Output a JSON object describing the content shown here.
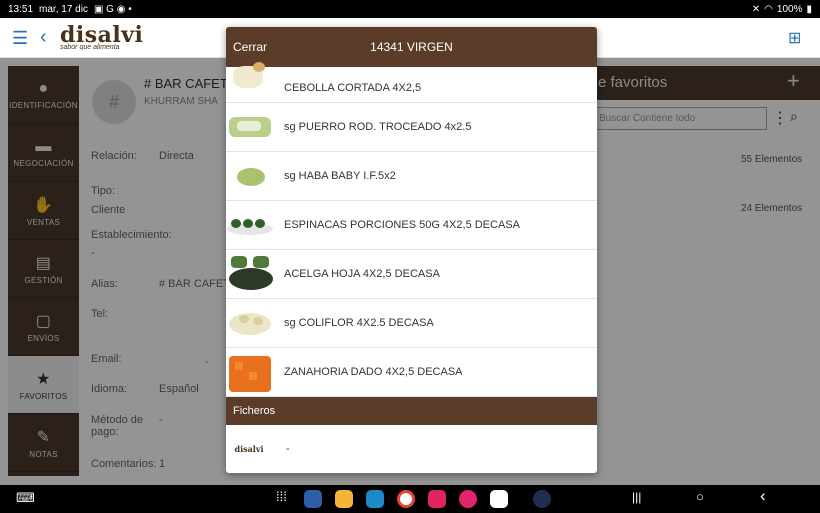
{
  "status": {
    "time": "13:51",
    "date": "mar, 17 dic",
    "battery": "100%"
  },
  "logo": {
    "brand": "disalvi",
    "tagline": "sabor que alimenta"
  },
  "sidebar": {
    "items": [
      {
        "label": "IDENTIFICACIÓN",
        "icon": "person-icon"
      },
      {
        "label": "NEGOCIACIÓN",
        "icon": "briefcase-icon"
      },
      {
        "label": "VENTAS",
        "icon": "handshake-icon"
      },
      {
        "label": "GESTIÓN",
        "icon": "clipboard-icon"
      },
      {
        "label": "ENVÍOS",
        "icon": "book-icon"
      },
      {
        "label": "FAVORITOS",
        "icon": "star-icon"
      },
      {
        "label": "NOTAS",
        "icon": "notes-icon"
      }
    ]
  },
  "background": {
    "client_title": "# BAR CAFET",
    "client_sub": "KHURRAM SHA",
    "fields": [
      {
        "label": "Relación:",
        "value": "Directa"
      },
      {
        "label": "Tipo:",
        "value": "Cliente"
      },
      {
        "label": "Establecimiento:",
        "value": "-"
      },
      {
        "label": "Alias:",
        "value": "# BAR CAFET"
      },
      {
        "label": "Tel:",
        "value": ""
      },
      {
        "label": "Email:",
        "value": "-"
      },
      {
        "label": "Idioma:",
        "value": "Español"
      },
      {
        "label": "Método de pago:",
        "value": "-"
      },
      {
        "label": "Comentarios:",
        "value": "1"
      }
    ],
    "favorites_title": "e favoritos",
    "search_placeholder": "Buscar Contiene todo",
    "counts": [
      "55 Elementos",
      "24 Elementos"
    ]
  },
  "modal": {
    "close_label": "Cerrar",
    "title": "14341 VIRGEN",
    "products": [
      "CEBOLLA CORTADA 4X2,5",
      "sg PUERRO ROD. TROCEADO 4x2.5",
      "sg HABA BABY I.F.5x2",
      "ESPINACAS PORCIONES 50G 4X2,5 DECASA",
      "ACELGA HOJA 4X2,5 DECASA",
      "sg COLIFLOR 4X2.5 DECASA",
      "ZANAHORIA DADO 4X2,5 DECASA"
    ],
    "files_label": "Ficheros",
    "file_name": "-",
    "file_logo": "disalvi"
  }
}
